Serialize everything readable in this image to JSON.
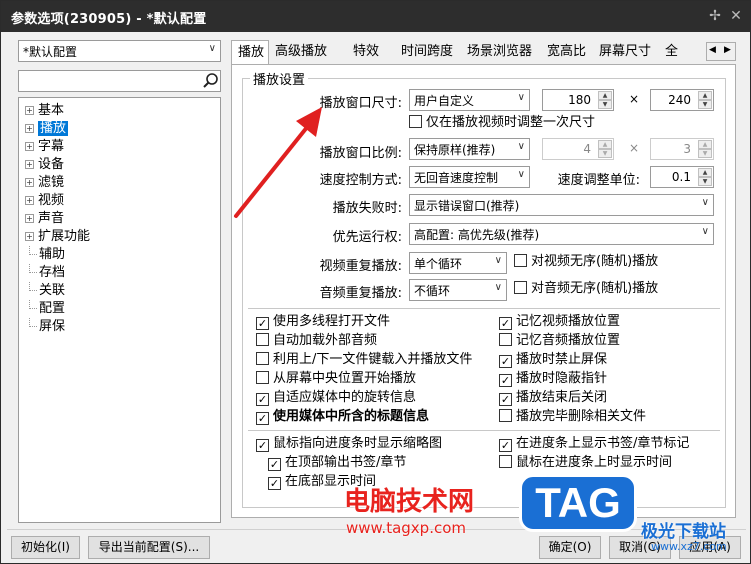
{
  "window": {
    "title": "参数选项(230905) - *默认配置",
    "pin_icon": "pin-icon",
    "close_icon": "close-icon"
  },
  "profile": {
    "selected": "*默认配置"
  },
  "search": {
    "value": "",
    "placeholder": ""
  },
  "tree": [
    {
      "label": "基本",
      "expandable": true
    },
    {
      "label": "播放",
      "expandable": true,
      "selected": true
    },
    {
      "label": "字幕",
      "expandable": true
    },
    {
      "label": "设备",
      "expandable": true
    },
    {
      "label": "滤镜",
      "expandable": true
    },
    {
      "label": "视频",
      "expandable": true
    },
    {
      "label": "声音",
      "expandable": true
    },
    {
      "label": "扩展功能",
      "expandable": true
    },
    {
      "label": "辅助",
      "expandable": false
    },
    {
      "label": "存档",
      "expandable": false
    },
    {
      "label": "关联",
      "expandable": false
    },
    {
      "label": "配置",
      "expandable": false
    },
    {
      "label": "屏保",
      "expandable": false
    }
  ],
  "tabs": [
    "播放",
    "高级播放",
    "特效",
    "时间跨度",
    "场景浏览器",
    "宽高比",
    "屏幕尺寸",
    "全"
  ],
  "group_title": "播放设置",
  "settings": {
    "window_size_label": "播放窗口尺寸:",
    "window_size_value": "用户自定义",
    "width": "180",
    "times": "×",
    "height": "240",
    "adjust_once": "仅在播放视频时调整一次尺寸",
    "window_ratio_label": "播放窗口比例:",
    "window_ratio_value": "保持原样(推荐)",
    "ratio_w": "4",
    "ratio_h": "3",
    "speed_mode_label": "速度控制方式:",
    "speed_mode_value": "无回音速度控制",
    "speed_unit_label": "速度调整单位:",
    "speed_unit_value": "0.1",
    "fail_label": "播放失败时:",
    "fail_value": "显示错误窗口(推荐)",
    "priority_label": "优先运行权:",
    "priority_value": "高配置: 高优先级(推荐)",
    "video_repeat_label": "视频重复播放:",
    "video_repeat_value": "单个循环",
    "video_shuffle": "对视频无序(随机)播放",
    "audio_repeat_label": "音频重复播放:",
    "audio_repeat_value": "不循环",
    "audio_shuffle": "对音频无序(随机)播放"
  },
  "checks_left": [
    {
      "label": "使用多线程打开文件",
      "checked": true
    },
    {
      "label": "自动加载外部音频",
      "checked": false
    },
    {
      "label": "利用上/下一文件键载入并播放文件",
      "checked": false
    },
    {
      "label": "从屏幕中央位置开始播放",
      "checked": false
    },
    {
      "label": "自适应媒体中的旋转信息",
      "checked": true
    },
    {
      "label": "使用媒体中所含的标题信息",
      "checked": true,
      "bold": true
    }
  ],
  "checks_right": [
    {
      "label": "记忆视频播放位置",
      "checked": true
    },
    {
      "label": "记忆音频播放位置",
      "checked": false
    },
    {
      "label": "播放时禁止屏保",
      "checked": true
    },
    {
      "label": "播放时隐蔽指针",
      "checked": true
    },
    {
      "label": "播放结束后关闭",
      "checked": true
    },
    {
      "label": "播放完毕删除相关文件",
      "checked": false
    }
  ],
  "seek": {
    "thumb": {
      "label": "鼠标指向进度条时显示缩略图",
      "checked": true
    },
    "top": {
      "label": "在顶部输出书签/章节",
      "checked": true
    },
    "bottom": {
      "label": "在底部显示时间",
      "checked": true
    },
    "show_marks": {
      "label": "在进度条上显示书签/章节标记",
      "checked": true
    },
    "show_time": {
      "label": "鼠标在进度条上时显示时间",
      "checked": false
    }
  },
  "footer": {
    "init": "初始化(I)",
    "export": "导出当前配置(S)...",
    "ok": "确定(O)",
    "cancel": "取消(C)",
    "apply": "应用(A)"
  },
  "watermark": {
    "site_name": "电脑技术网",
    "site_url": "www.tagxp.com",
    "logo": "TAG",
    "download": "极光下载站",
    "download_url": "www.xz7.com"
  },
  "colors": {
    "accent": "#0078d7",
    "arrow": "#e02020",
    "watermark_red": "#e8231e",
    "logo_blue": "#1a6fd4"
  }
}
